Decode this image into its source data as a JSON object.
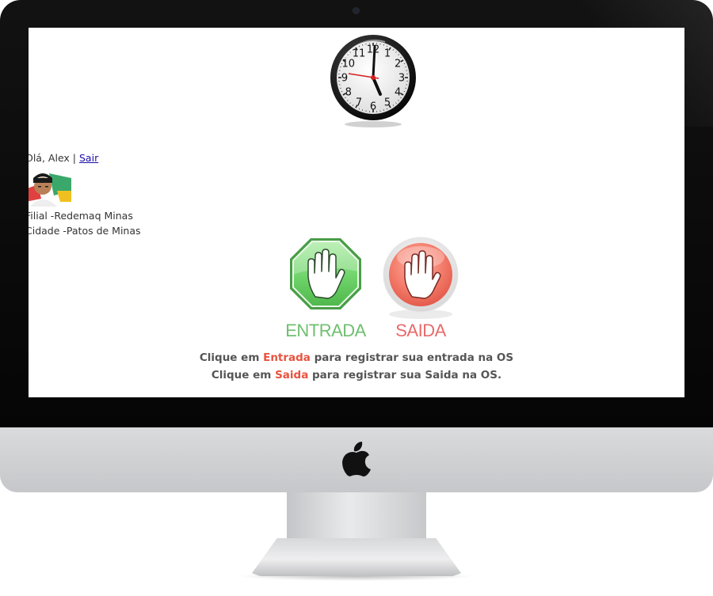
{
  "header": {
    "greeting": "Olá, Alex",
    "separator": "|",
    "logout_label": "Sair"
  },
  "user": {
    "filial": "Filial -Redemaq Minas",
    "cidade": "Cidade -Patos de Minas"
  },
  "buttons": {
    "entrada_label": "ENTRADA",
    "saida_label": "SAIDA"
  },
  "instructions": {
    "line1": {
      "prefix": "Clique em",
      "highlight": "Entrada",
      "suffix": "para registrar sua entrada na OS"
    },
    "line2": {
      "prefix": "Clique em",
      "highlight": "Saida",
      "suffix": "para registrar sua Saida na OS."
    }
  },
  "clock": {
    "numbers": [
      "12",
      "1",
      "2",
      "3",
      "4",
      "5",
      "6",
      "7",
      "8",
      "9",
      "10",
      "11"
    ]
  },
  "icons": {
    "entrada": "hand-stop-icon",
    "saida": "hand-stop-icon",
    "clock": "analog-clock-icon",
    "brand": "apple-logo-icon"
  },
  "colors": {
    "entrada": "#6fbf6f",
    "saida": "#e8533f",
    "link": "#1a0dab"
  }
}
